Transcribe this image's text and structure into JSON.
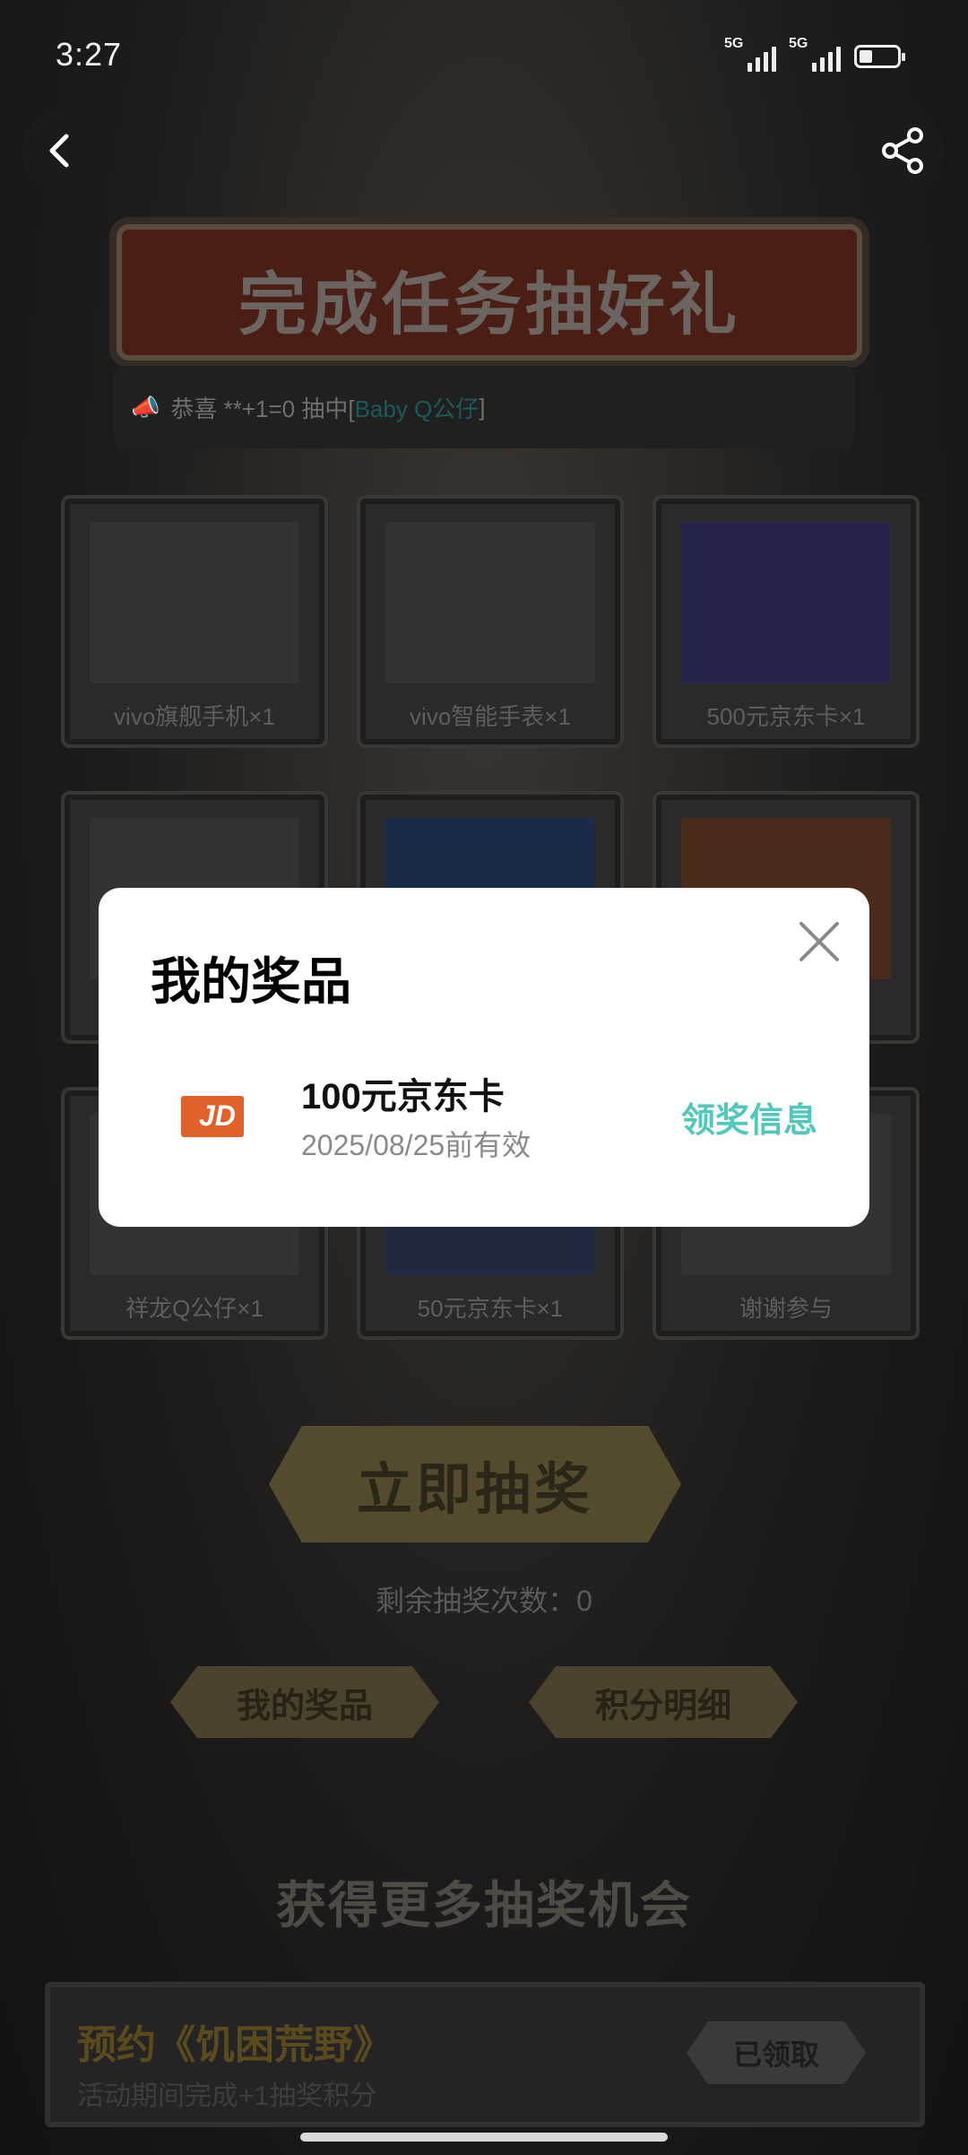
{
  "status_bar": {
    "time": "3:27",
    "signal1_label": "5G",
    "signal2_label": "5G"
  },
  "page": {
    "banner_title": "完成任务抽好礼",
    "ticker": {
      "prefix": "恭喜 **+1=0 抽中[",
      "prize": " Baby Q公仔 ",
      "suffix": "]"
    },
    "prizes": [
      {
        "label": "vivo旗舰手机×1"
      },
      {
        "label": "vivo智能手表×1"
      },
      {
        "label": "500元京东卡×1"
      },
      {
        "label": ""
      },
      {
        "label": ""
      },
      {
        "label": ""
      },
      {
        "label": "祥龙Q公仔×1"
      },
      {
        "label": "50元京东卡×1"
      },
      {
        "label": "谢谢参与"
      }
    ],
    "draw_button": "立即抽奖",
    "remaining_draws": "剩余抽奖次数：0",
    "my_prizes_button": "我的奖品",
    "points_detail_button": "积分明细",
    "more_chances_title": "获得更多抽奖机会",
    "task": {
      "title": "预约《饥困荒野》",
      "desc": "活动期间完成+1抽奖积分",
      "status": "已领取"
    }
  },
  "modal": {
    "title": "我的奖品",
    "prize_name": "100元京东卡",
    "expiry": "2025/08/25前有效",
    "claim_info": "领奖信息"
  },
  "colors": {
    "accent_teal": "#52c7bb",
    "jd_card_orange": "#e2612b",
    "overlay_bg": "#141416"
  }
}
